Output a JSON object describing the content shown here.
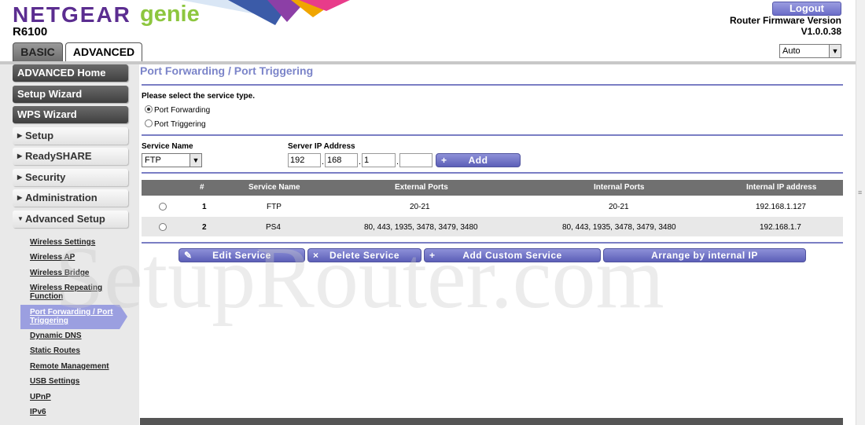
{
  "header": {
    "brand": "NETGEAR",
    "brand_genie": "genie",
    "model": "R6100",
    "logout_label": "Logout",
    "firmware_label": "Router Firmware Version",
    "firmware_version": "V1.0.0.38",
    "language_value": "Auto"
  },
  "tabs": {
    "basic": "BASIC",
    "advanced": "ADVANCED"
  },
  "sidebar": {
    "top_buttons": [
      "ADVANCED Home",
      "Setup Wizard",
      "WPS Wizard"
    ],
    "sections": [
      "Setup",
      "ReadySHARE",
      "Security",
      "Administration",
      "Advanced Setup"
    ],
    "sub_items": [
      "Wireless Settings",
      "Wireless AP",
      "Wireless Bridge",
      "Wireless Repeating Function",
      "Port Forwarding / Port Triggering",
      "Dynamic DNS",
      "Static Routes",
      "Remote Management",
      "USB Settings",
      "UPnP",
      "IPv6"
    ]
  },
  "main": {
    "title": "Port Forwarding / Port Triggering",
    "select_prompt": "Please select the service type.",
    "radio_forwarding": "Port Forwarding",
    "radio_triggering": "Port Triggering",
    "service_name_label": "Service Name",
    "server_ip_label": "Server IP Address",
    "service_name_value": "FTP",
    "ip": [
      "192",
      "168",
      "1",
      ""
    ],
    "add_label": "Add",
    "table": {
      "headers": [
        "#",
        "Service Name",
        "External Ports",
        "Internal Ports",
        "Internal IP address"
      ],
      "rows": [
        [
          "1",
          "FTP",
          "20-21",
          "20-21",
          "192.168.1.127"
        ],
        [
          "2",
          "PS4",
          "80, 443, 1935, 3478, 3479, 3480",
          "80, 443, 1935, 3478, 3479, 3480",
          "192.168.1.7"
        ]
      ]
    },
    "buttons": {
      "edit": "Edit Service",
      "delete": "Delete Service",
      "add_custom": "Add Custom Service",
      "arrange": "Arrange by internal IP"
    }
  },
  "watermark": "SetupRouter.com",
  "colors": {
    "accent": "#7b84c9",
    "button": "#6a6dc4",
    "brand": "#5b2d90",
    "genie": "#8dc63f"
  }
}
